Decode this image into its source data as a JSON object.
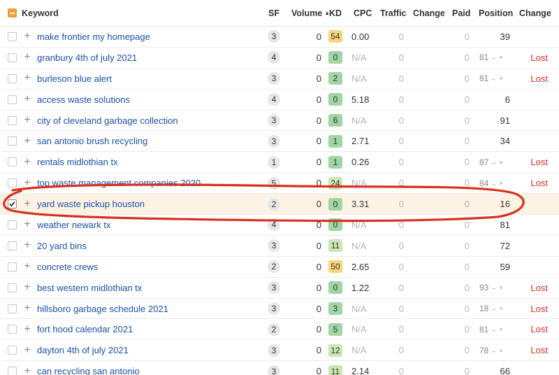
{
  "header": {
    "keyword": "Keyword",
    "sf": "SF",
    "volume": "Volume",
    "kd": "KD",
    "cpc": "CPC",
    "traffic": "Traffic",
    "change": "Change",
    "paid": "Paid",
    "position": "Position",
    "position_change": "Change",
    "sort_icon": "triangle-up-icon"
  },
  "rows": [
    {
      "keyword": "make frontier my homepage",
      "sf": "3",
      "volume": "0",
      "kd": "54",
      "kd_color": "yellow",
      "cpc": "0.00",
      "traffic": "0",
      "paid": "0",
      "position": "39",
      "old_position": "",
      "lost": ""
    },
    {
      "keyword": "granbury 4th of july 2021",
      "sf": "4",
      "volume": "0",
      "kd": "0",
      "kd_color": "green",
      "cpc": "N/A",
      "traffic": "0",
      "paid": "0",
      "position": "",
      "old_position": "81",
      "lost": "Lost"
    },
    {
      "keyword": "burleson blue alert",
      "sf": "3",
      "volume": "0",
      "kd": "2",
      "kd_color": "green",
      "cpc": "N/A",
      "traffic": "0",
      "paid": "0",
      "position": "",
      "old_position": "81",
      "lost": "Lost"
    },
    {
      "keyword": "access waste solutions",
      "sf": "4",
      "volume": "0",
      "kd": "0",
      "kd_color": "green",
      "cpc": "5.18",
      "traffic": "0",
      "paid": "0",
      "position": "6",
      "old_position": "",
      "lost": ""
    },
    {
      "keyword": "city of cleveland garbage collection",
      "sf": "3",
      "volume": "0",
      "kd": "6",
      "kd_color": "green",
      "cpc": "N/A",
      "traffic": "0",
      "paid": "0",
      "position": "91",
      "old_position": "",
      "lost": ""
    },
    {
      "keyword": "san antonio brush recycling",
      "sf": "3",
      "volume": "0",
      "kd": "1",
      "kd_color": "green",
      "cpc": "2.71",
      "traffic": "0",
      "paid": "0",
      "position": "34",
      "old_position": "",
      "lost": ""
    },
    {
      "keyword": "rentals midlothian tx",
      "sf": "1",
      "volume": "0",
      "kd": "1",
      "kd_color": "green",
      "cpc": "0.26",
      "traffic": "0",
      "paid": "0",
      "position": "",
      "old_position": "87",
      "lost": "Lost"
    },
    {
      "keyword": "top waste management companies 2020",
      "sf": "5",
      "volume": "0",
      "kd": "24",
      "kd_color": "lightgreen",
      "cpc": "N/A",
      "traffic": "0",
      "paid": "0",
      "position": "",
      "old_position": "84",
      "lost": "Lost"
    },
    {
      "keyword": "yard waste pickup houston",
      "sf": "2",
      "volume": "0",
      "kd": "0",
      "kd_color": "green",
      "cpc": "3.31",
      "traffic": "0",
      "paid": "0",
      "position": "16",
      "old_position": "",
      "lost": "",
      "selected": true
    },
    {
      "keyword": "weather newark tx",
      "sf": "4",
      "volume": "0",
      "kd": "0",
      "kd_color": "green",
      "cpc": "N/A",
      "traffic": "0",
      "paid": "0",
      "position": "81",
      "old_position": "",
      "lost": ""
    },
    {
      "keyword": "20 yard bins",
      "sf": "3",
      "volume": "0",
      "kd": "11",
      "kd_color": "lightgreen",
      "cpc": "N/A",
      "traffic": "0",
      "paid": "0",
      "position": "72",
      "old_position": "",
      "lost": ""
    },
    {
      "keyword": "concrete crews",
      "sf": "2",
      "volume": "0",
      "kd": "50",
      "kd_color": "yellow",
      "cpc": "2.65",
      "traffic": "0",
      "paid": "0",
      "position": "59",
      "old_position": "",
      "lost": ""
    },
    {
      "keyword": "best western midlothian tx",
      "sf": "3",
      "volume": "0",
      "kd": "0",
      "kd_color": "green",
      "cpc": "1.22",
      "traffic": "0",
      "paid": "0",
      "position": "",
      "old_position": "93",
      "lost": "Lost"
    },
    {
      "keyword": "hillsboro garbage schedule 2021",
      "sf": "3",
      "volume": "0",
      "kd": "3",
      "kd_color": "green",
      "cpc": "N/A",
      "traffic": "0",
      "paid": "0",
      "position": "",
      "old_position": "18",
      "lost": "Lost"
    },
    {
      "keyword": "fort hood calendar 2021",
      "sf": "2",
      "volume": "0",
      "kd": "5",
      "kd_color": "green",
      "cpc": "N/A",
      "traffic": "0",
      "paid": "0",
      "position": "",
      "old_position": "81",
      "lost": "Lost"
    },
    {
      "keyword": "dayton 4th of july 2021",
      "sf": "3",
      "volume": "0",
      "kd": "12",
      "kd_color": "lightgreen",
      "cpc": "N/A",
      "traffic": "0",
      "paid": "0",
      "position": "",
      "old_position": "78",
      "lost": "Lost"
    },
    {
      "keyword": "can recycling san antonio",
      "sf": "3",
      "volume": "0",
      "kd": "11",
      "kd_color": "lightgreen",
      "cpc": "2.14",
      "traffic": "0",
      "paid": "0",
      "position": "66",
      "old_position": "",
      "lost": ""
    }
  ],
  "glyphs": {
    "arrow": "→",
    "x": "×",
    "plus": "+"
  },
  "colors": {
    "accent": "#f59d3d",
    "link": "#1d4fa8",
    "lost": "#d93025",
    "highlight_row": "#fdf3e5",
    "annotation": "#d9301e"
  }
}
